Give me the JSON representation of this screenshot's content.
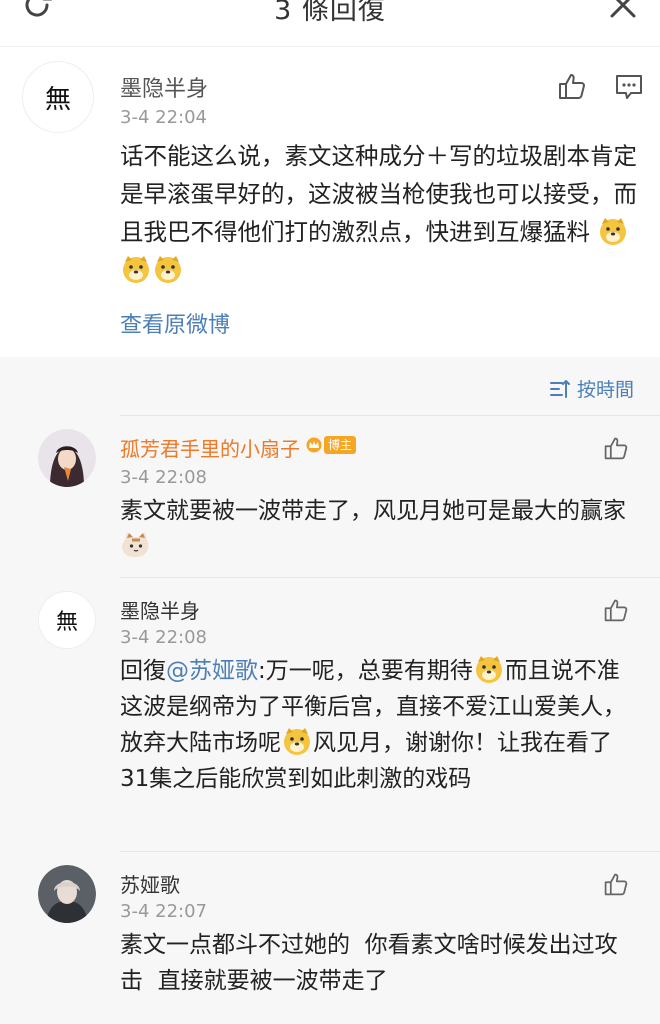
{
  "header": {
    "title": "3 條回復",
    "refresh_icon": "refresh-icon",
    "close_icon": "close-icon"
  },
  "main_comment": {
    "avatar_text": "無",
    "user": "墨隐半身",
    "time": "3-4 22:04",
    "text": "话不能这么说，素文这种成分＋写的垃圾剧本肯定是早滚蛋早好的，这波被当枪使我也可以接受，而且我巴不得他们打的激烈点，快进到互爆猛料",
    "emojis": [
      "doge-emoji",
      "doge-emoji",
      "doge-emoji"
    ],
    "view_original": "查看原微博"
  },
  "sort": {
    "label": "按時間",
    "icon": "sort-icon"
  },
  "replies": [
    {
      "user": "孤芳君手里的小扇子",
      "badge": "博主",
      "time": "3-4 22:08",
      "text": "素文就要被一波带走了，风见月她可是最大的赢家",
      "emoji": "cat-emoji"
    },
    {
      "avatar_text": "無",
      "user": "墨隐半身",
      "time": "3-4 22:08",
      "reply_prefix": "回復",
      "mention": "@苏娅歌",
      "part1": ":万一呢，总要有期待",
      "part2": "而且说不准这波是纲帝为了平衡后宫，直接不爱江山爱美人，放弃大陆市场呢",
      "part3": "风见月，谢谢你！让我在看了31集之后能欣赏到如此刺激的戏码"
    },
    {
      "user": "苏娅歌",
      "time": "3-4 22:07",
      "text": "素文一点都斗不过她的  你看素文啥时候发出过攻击  直接就要被一波带走了"
    }
  ],
  "colors": {
    "link": "#4c7fb8",
    "vip_name": "#f07826",
    "badge": "#f5a623",
    "reply_bg": "#f7f7f7"
  }
}
